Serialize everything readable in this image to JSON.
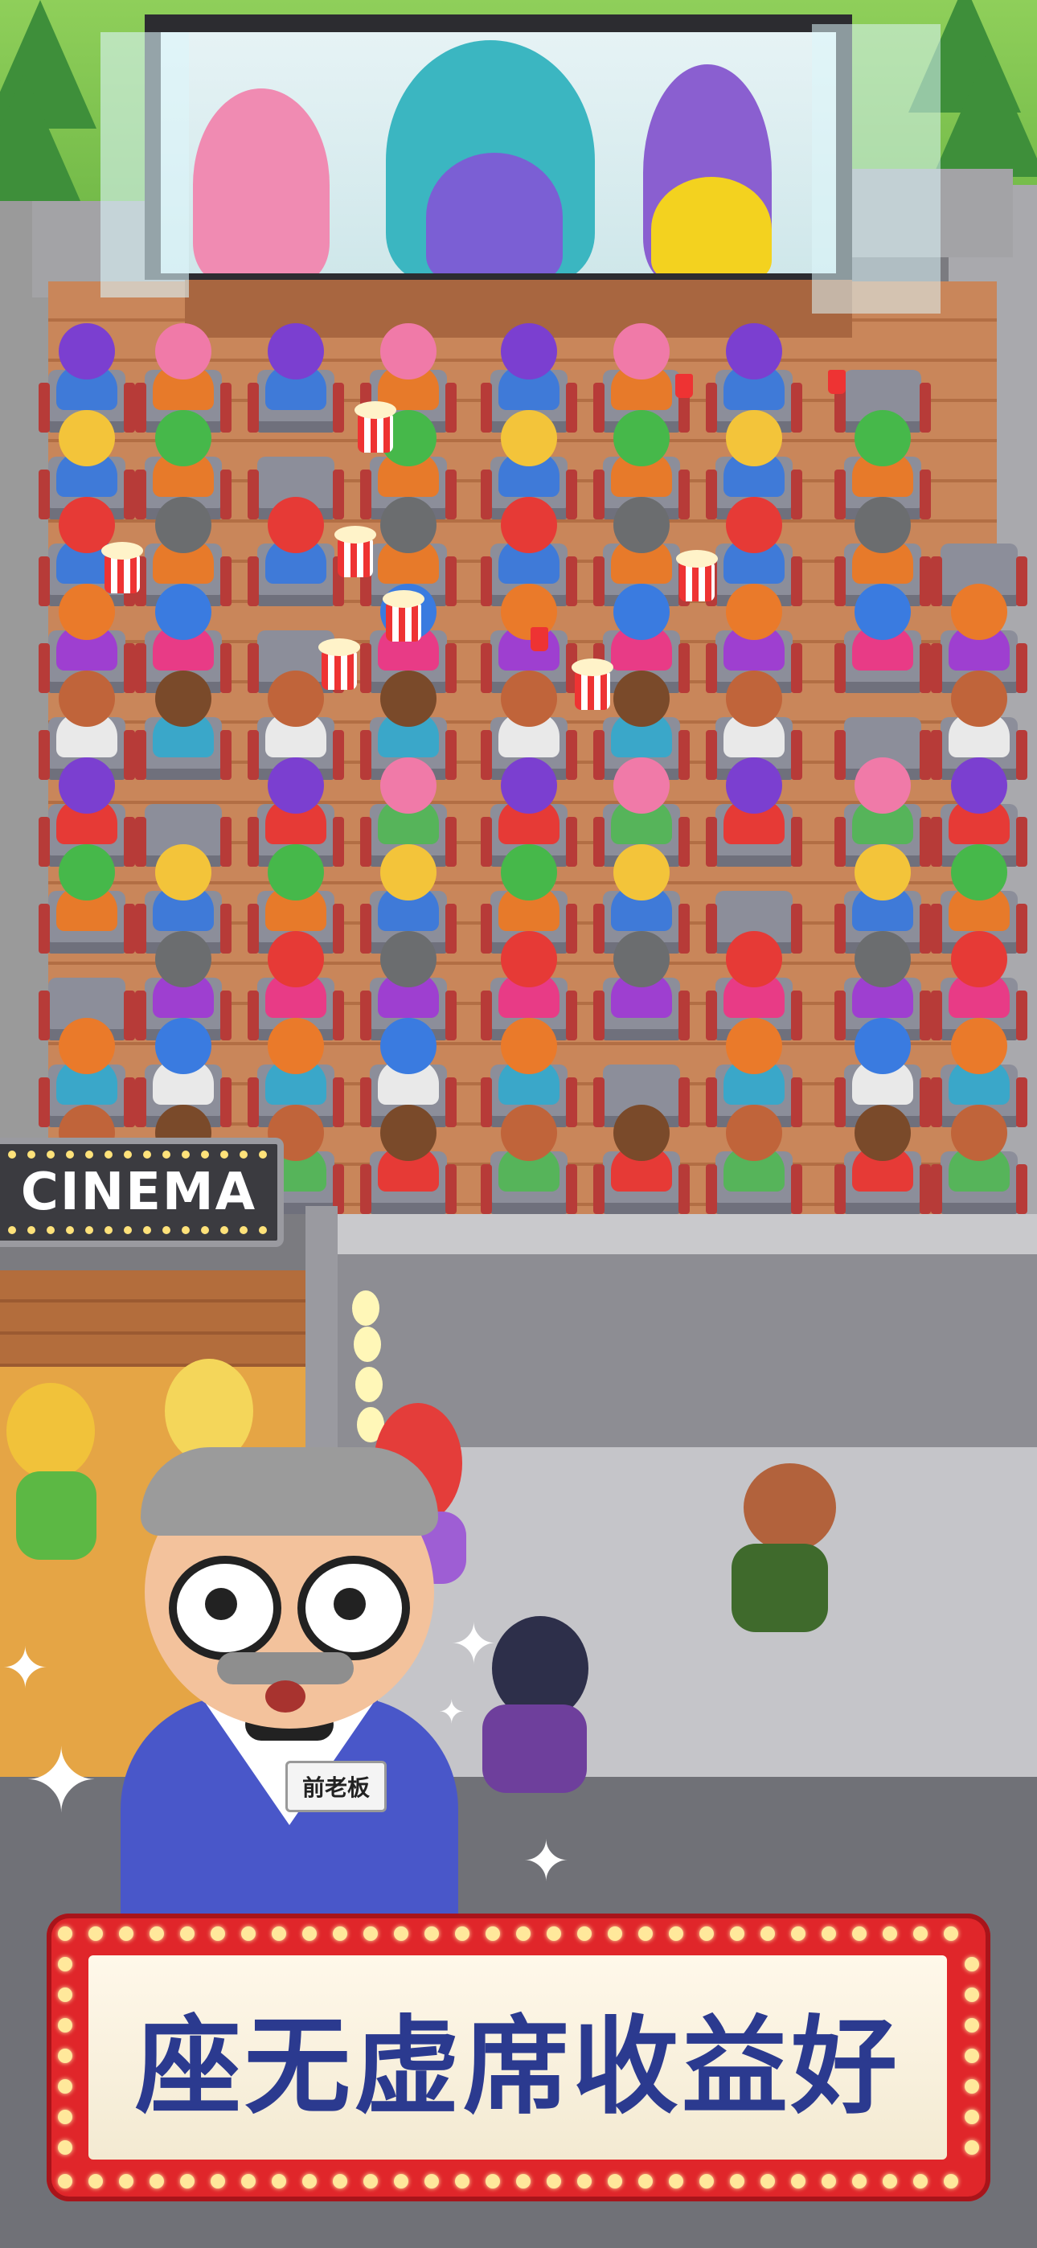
{
  "game": {
    "cinema_sign": "CINEMA",
    "mascot_badge": "前老板",
    "banner_text": "座无虚席收益好"
  },
  "colors": {
    "banner_red": "#e0262a",
    "banner_text": "#2b3a8f",
    "floor_wood": "#c9865a",
    "seat_gray": "#8c8e9a",
    "seat_arm_red": "#b73b38"
  },
  "icons": {
    "popcorn": "popcorn-bucket-icon",
    "drink": "soda-cup-icon",
    "sparkle": "sparkle-icon"
  }
}
